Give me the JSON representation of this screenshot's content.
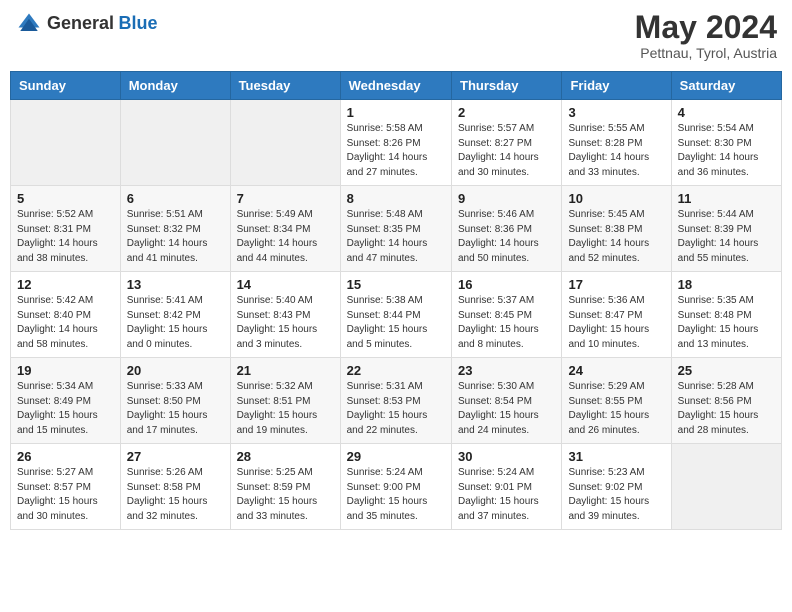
{
  "header": {
    "logo_general": "General",
    "logo_blue": "Blue",
    "month_year": "May 2024",
    "location": "Pettnau, Tyrol, Austria"
  },
  "days_of_week": [
    "Sunday",
    "Monday",
    "Tuesday",
    "Wednesday",
    "Thursday",
    "Friday",
    "Saturday"
  ],
  "weeks": [
    [
      {
        "day": "",
        "info": ""
      },
      {
        "day": "",
        "info": ""
      },
      {
        "day": "",
        "info": ""
      },
      {
        "day": "1",
        "info": "Sunrise: 5:58 AM\nSunset: 8:26 PM\nDaylight: 14 hours\nand 27 minutes."
      },
      {
        "day": "2",
        "info": "Sunrise: 5:57 AM\nSunset: 8:27 PM\nDaylight: 14 hours\nand 30 minutes."
      },
      {
        "day": "3",
        "info": "Sunrise: 5:55 AM\nSunset: 8:28 PM\nDaylight: 14 hours\nand 33 minutes."
      },
      {
        "day": "4",
        "info": "Sunrise: 5:54 AM\nSunset: 8:30 PM\nDaylight: 14 hours\nand 36 minutes."
      }
    ],
    [
      {
        "day": "5",
        "info": "Sunrise: 5:52 AM\nSunset: 8:31 PM\nDaylight: 14 hours\nand 38 minutes."
      },
      {
        "day": "6",
        "info": "Sunrise: 5:51 AM\nSunset: 8:32 PM\nDaylight: 14 hours\nand 41 minutes."
      },
      {
        "day": "7",
        "info": "Sunrise: 5:49 AM\nSunset: 8:34 PM\nDaylight: 14 hours\nand 44 minutes."
      },
      {
        "day": "8",
        "info": "Sunrise: 5:48 AM\nSunset: 8:35 PM\nDaylight: 14 hours\nand 47 minutes."
      },
      {
        "day": "9",
        "info": "Sunrise: 5:46 AM\nSunset: 8:36 PM\nDaylight: 14 hours\nand 50 minutes."
      },
      {
        "day": "10",
        "info": "Sunrise: 5:45 AM\nSunset: 8:38 PM\nDaylight: 14 hours\nand 52 minutes."
      },
      {
        "day": "11",
        "info": "Sunrise: 5:44 AM\nSunset: 8:39 PM\nDaylight: 14 hours\nand 55 minutes."
      }
    ],
    [
      {
        "day": "12",
        "info": "Sunrise: 5:42 AM\nSunset: 8:40 PM\nDaylight: 14 hours\nand 58 minutes."
      },
      {
        "day": "13",
        "info": "Sunrise: 5:41 AM\nSunset: 8:42 PM\nDaylight: 15 hours\nand 0 minutes."
      },
      {
        "day": "14",
        "info": "Sunrise: 5:40 AM\nSunset: 8:43 PM\nDaylight: 15 hours\nand 3 minutes."
      },
      {
        "day": "15",
        "info": "Sunrise: 5:38 AM\nSunset: 8:44 PM\nDaylight: 15 hours\nand 5 minutes."
      },
      {
        "day": "16",
        "info": "Sunrise: 5:37 AM\nSunset: 8:45 PM\nDaylight: 15 hours\nand 8 minutes."
      },
      {
        "day": "17",
        "info": "Sunrise: 5:36 AM\nSunset: 8:47 PM\nDaylight: 15 hours\nand 10 minutes."
      },
      {
        "day": "18",
        "info": "Sunrise: 5:35 AM\nSunset: 8:48 PM\nDaylight: 15 hours\nand 13 minutes."
      }
    ],
    [
      {
        "day": "19",
        "info": "Sunrise: 5:34 AM\nSunset: 8:49 PM\nDaylight: 15 hours\nand 15 minutes."
      },
      {
        "day": "20",
        "info": "Sunrise: 5:33 AM\nSunset: 8:50 PM\nDaylight: 15 hours\nand 17 minutes."
      },
      {
        "day": "21",
        "info": "Sunrise: 5:32 AM\nSunset: 8:51 PM\nDaylight: 15 hours\nand 19 minutes."
      },
      {
        "day": "22",
        "info": "Sunrise: 5:31 AM\nSunset: 8:53 PM\nDaylight: 15 hours\nand 22 minutes."
      },
      {
        "day": "23",
        "info": "Sunrise: 5:30 AM\nSunset: 8:54 PM\nDaylight: 15 hours\nand 24 minutes."
      },
      {
        "day": "24",
        "info": "Sunrise: 5:29 AM\nSunset: 8:55 PM\nDaylight: 15 hours\nand 26 minutes."
      },
      {
        "day": "25",
        "info": "Sunrise: 5:28 AM\nSunset: 8:56 PM\nDaylight: 15 hours\nand 28 minutes."
      }
    ],
    [
      {
        "day": "26",
        "info": "Sunrise: 5:27 AM\nSunset: 8:57 PM\nDaylight: 15 hours\nand 30 minutes."
      },
      {
        "day": "27",
        "info": "Sunrise: 5:26 AM\nSunset: 8:58 PM\nDaylight: 15 hours\nand 32 minutes."
      },
      {
        "day": "28",
        "info": "Sunrise: 5:25 AM\nSunset: 8:59 PM\nDaylight: 15 hours\nand 33 minutes."
      },
      {
        "day": "29",
        "info": "Sunrise: 5:24 AM\nSunset: 9:00 PM\nDaylight: 15 hours\nand 35 minutes."
      },
      {
        "day": "30",
        "info": "Sunrise: 5:24 AM\nSunset: 9:01 PM\nDaylight: 15 hours\nand 37 minutes."
      },
      {
        "day": "31",
        "info": "Sunrise: 5:23 AM\nSunset: 9:02 PM\nDaylight: 15 hours\nand 39 minutes."
      },
      {
        "day": "",
        "info": ""
      }
    ]
  ]
}
